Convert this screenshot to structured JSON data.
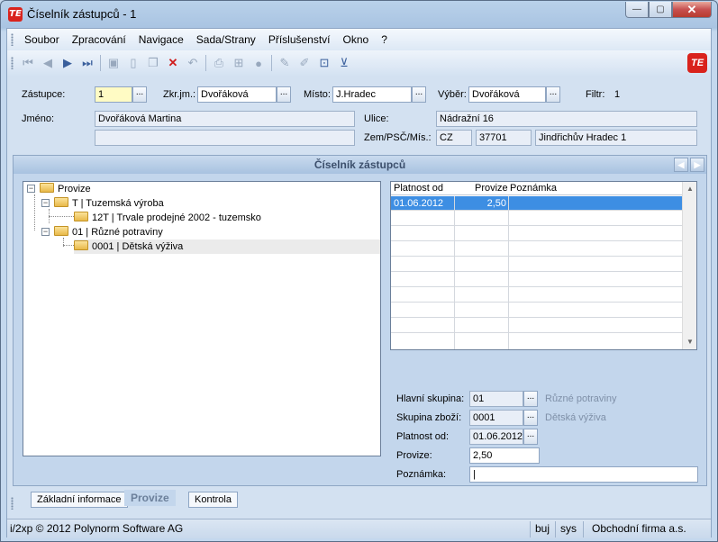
{
  "window": {
    "title": "Číselník zástupců - 1",
    "app_icon_text": "TE",
    "btn_minimize": "—",
    "btn_maximize": "▢",
    "btn_close": "✕"
  },
  "menu": {
    "items": [
      "Soubor",
      "Zpracování",
      "Navigace",
      "Sada/Strany",
      "Příslušenství",
      "Okno",
      "?"
    ]
  },
  "toolbar": {
    "icons": [
      "first-record-icon",
      "previous-record-icon",
      "next-record-icon",
      "last-record-icon",
      "save-icon",
      "new-document-icon",
      "copy-icon",
      "delete-icon",
      "undo-icon",
      "print-icon",
      "tree-view-icon",
      "stop-icon",
      "edit-icon",
      "edit-disabled-icon",
      "export-icon",
      "filter-icon"
    ],
    "brand_text": "TE"
  },
  "form": {
    "zastupce_label": "Zástupce:",
    "zastupce_value": "1",
    "zkrjm_label": "Zkr.jm.:",
    "zkrjm_value": "Dvořáková",
    "misto_label": "Místo:",
    "misto_value": "J.Hradec",
    "vyber_label": "Výběr:",
    "vyber_value": "Dvořáková",
    "filtr_label": "Filtr:",
    "filtr_value": "1",
    "jmeno_label": "Jméno:",
    "jmeno_value": "Dvořáková Martina",
    "jmeno2_value": "",
    "ulice_label": "Ulice:",
    "ulice_value": "Nádražní 16",
    "zem_label": "Zem/PSČ/Mís.:",
    "zem_value": "CZ",
    "psc_value": "37701",
    "mesto_value": "Jindřichův Hradec 1",
    "dots": "..."
  },
  "panel": {
    "title": "Číselník zástupců",
    "prev_arrow": "◀",
    "next_arrow": "▶"
  },
  "tree": {
    "nodes": [
      {
        "label": "Provize",
        "expander": "−"
      },
      {
        "label": "T | Tuzemská výroba",
        "expander": "−"
      },
      {
        "label": "12T | Trvale prodejné 2002 - tuzemsko",
        "expander": ""
      },
      {
        "label": "01 | Různé potraviny",
        "expander": "−"
      },
      {
        "label": "0001 | Dětská výživa",
        "expander": ""
      }
    ]
  },
  "grid": {
    "col_platnost": "Platnost od",
    "col_provize": "Provize",
    "col_poznamka": "Poznámka",
    "rows": [
      {
        "platnost": "01.06.2012",
        "provize": "2,50",
        "poznamka": ""
      }
    ],
    "scroll_up": "▲",
    "scroll_down": "▼"
  },
  "detail": {
    "hlavni_label": "Hlavní skupina:",
    "hlavni_value": "01",
    "hlavni_desc": "Různé potraviny",
    "skupina_label": "Skupina zboží:",
    "skupina_value": "0001",
    "skupina_desc": "Dětská výživa",
    "platnost_label": "Platnost od:",
    "platnost_value": "01.06.2012",
    "provize_label": "Provize:",
    "provize_value": "2,50",
    "poznamka_label": "Poznámka:",
    "poznamka_value": "|"
  },
  "tabs": {
    "zakladni": "Základní informace",
    "provize": "Provize",
    "kontrola": "Kontrola"
  },
  "status": {
    "copyright": "i/2xp © 2012 Polynorm Software AG",
    "user": "buj",
    "db": "sys",
    "company": "Obchodní firma a.s."
  }
}
